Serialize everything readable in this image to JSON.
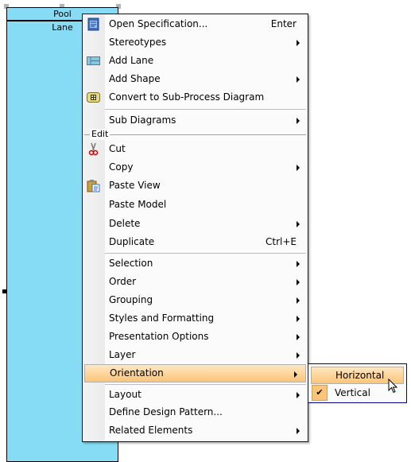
{
  "diagram": {
    "pool_label": "Pool",
    "lane_label": "Lane",
    "pool_color": "#87dcf5"
  },
  "menu": {
    "entries": [
      {
        "type": "item",
        "label": "Open Specification...",
        "shortcut": "Enter",
        "icon": "specification-icon",
        "h": 23
      },
      {
        "type": "item",
        "label": "Stereotypes",
        "submenu": true,
        "h": 23
      },
      {
        "type": "item",
        "label": "Add Lane",
        "icon": "add-lane-icon",
        "h": 23
      },
      {
        "type": "item",
        "label": "Add Shape",
        "submenu": true,
        "h": 23
      },
      {
        "type": "item",
        "label": "Convert to Sub-Process Diagram",
        "icon": "sub-process-icon",
        "h": 23
      },
      {
        "type": "separator",
        "h": 6
      },
      {
        "type": "item",
        "label": "Sub Diagrams",
        "submenu": true,
        "h": 22
      },
      {
        "type": "header",
        "label": "Edit",
        "h": 14
      },
      {
        "type": "item",
        "label": "Cut",
        "icon": "scissors-icon",
        "h": 23
      },
      {
        "type": "item",
        "label": "Copy",
        "submenu": true,
        "h": 23
      },
      {
        "type": "item",
        "label": "Paste View",
        "icon": "clipboard-icon",
        "h": 24
      },
      {
        "type": "item",
        "label": "Paste Model",
        "h": 24
      },
      {
        "type": "item",
        "label": "Delete",
        "submenu": true,
        "h": 23
      },
      {
        "type": "item",
        "label": "Duplicate",
        "shortcut": "Ctrl+E",
        "h": 23
      },
      {
        "type": "separator",
        "h": 4
      },
      {
        "type": "item",
        "label": "Selection",
        "submenu": true,
        "h": 23
      },
      {
        "type": "item",
        "label": "Order",
        "submenu": true,
        "h": 23
      },
      {
        "type": "item",
        "label": "Grouping",
        "submenu": true,
        "h": 23
      },
      {
        "type": "item",
        "label": "Styles and Formatting",
        "submenu": true,
        "h": 23
      },
      {
        "type": "item",
        "label": "Presentation Options",
        "submenu": true,
        "h": 23
      },
      {
        "type": "item",
        "label": "Layer",
        "submenu": true,
        "h": 23
      },
      {
        "type": "item",
        "label": "Orientation",
        "submenu": true,
        "highlighted": true,
        "h": 23
      },
      {
        "type": "separator",
        "h": 4
      },
      {
        "type": "item",
        "label": "Layout",
        "submenu": true,
        "h": 22
      },
      {
        "type": "item",
        "label": "Define Design Pattern...",
        "h": 23
      },
      {
        "type": "item",
        "label": "Related Elements",
        "submenu": true,
        "h": 23
      }
    ]
  },
  "submenu": {
    "items": [
      {
        "label": "Horizontal",
        "highlighted": true,
        "checked": false
      },
      {
        "label": "Vertical",
        "highlighted": false,
        "checked": true
      }
    ],
    "check_glyph": "✔"
  },
  "colors": {
    "highlight_top": "#ffe7c2",
    "highlight_bottom": "#fbc579",
    "menu_border": "#00008b"
  }
}
